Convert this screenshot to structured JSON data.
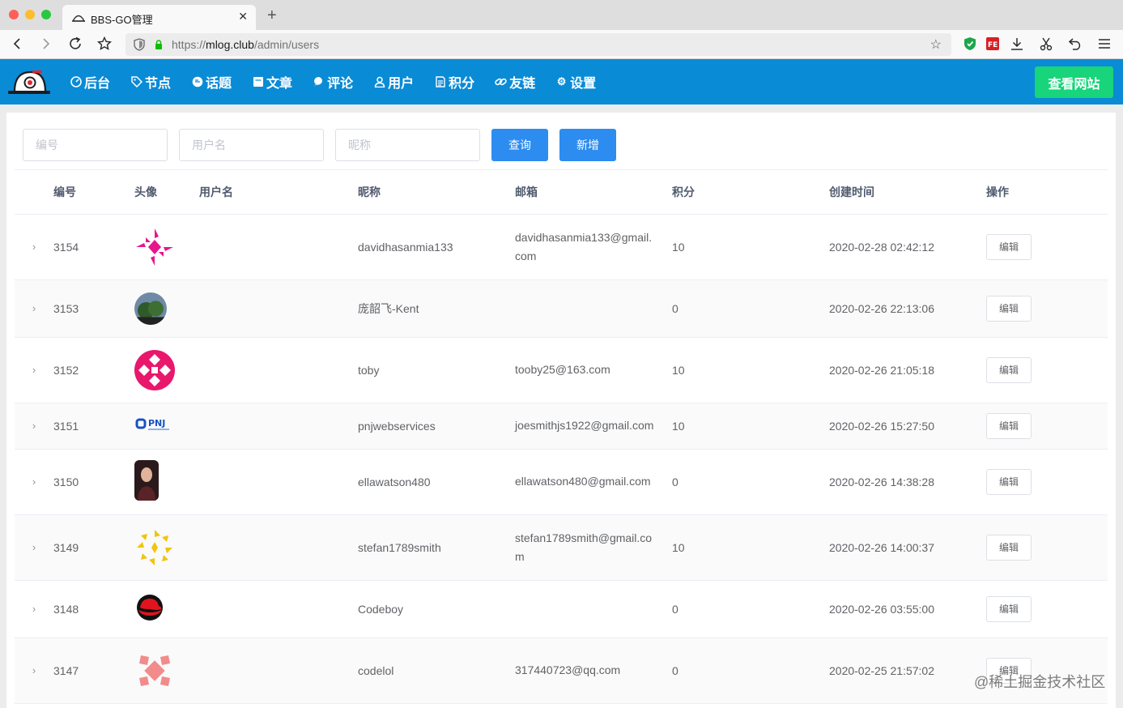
{
  "browser": {
    "tab_title": "BBS-GO管理",
    "url_prefix": "https://",
    "url_host": "mlog.club",
    "url_path": "/admin/users"
  },
  "header": {
    "menu": [
      {
        "label": "后台",
        "icon": "dashboard-icon"
      },
      {
        "label": "节点",
        "icon": "tag-icon"
      },
      {
        "label": "话题",
        "icon": "chat-bubble-icon"
      },
      {
        "label": "文章",
        "icon": "document-icon"
      },
      {
        "label": "评论",
        "icon": "comment-icon"
      },
      {
        "label": "用户",
        "icon": "user-icon"
      },
      {
        "label": "积分",
        "icon": "list-icon"
      },
      {
        "label": "友链",
        "icon": "link-icon"
      },
      {
        "label": "设置",
        "icon": "gear-icon"
      }
    ],
    "view_site": "查看网站"
  },
  "filters": {
    "id_placeholder": "编号",
    "username_placeholder": "用户名",
    "nickname_placeholder": "昵称",
    "query": "查询",
    "add": "新增"
  },
  "table": {
    "columns": [
      "编号",
      "头像",
      "用户名",
      "昵称",
      "邮箱",
      "积分",
      "创建时间",
      "操作"
    ],
    "edit_label": "编辑",
    "rows": [
      {
        "id": "3154",
        "username": "",
        "nickname": "davidhasanmia133",
        "email": "davidhasanmia133@gmail.com",
        "score": "10",
        "created": "2020-02-28 02:42:12",
        "avatar": "pink-identicon"
      },
      {
        "id": "3153",
        "username": "",
        "nickname": "庞韶飞-Kent",
        "email": "",
        "score": "0",
        "created": "2020-02-26 22:13:06",
        "avatar": "photo-trees"
      },
      {
        "id": "3152",
        "username": "",
        "nickname": "toby",
        "email": "tooby25@163.com",
        "score": "10",
        "created": "2020-02-26 21:05:18",
        "avatar": "magenta-identicon"
      },
      {
        "id": "3151",
        "username": "",
        "nickname": "pnjwebservices",
        "email": "joesmithjs1922@gmail.com",
        "score": "10",
        "created": "2020-02-26 15:27:50",
        "avatar": "pnj-logo"
      },
      {
        "id": "3150",
        "username": "",
        "nickname": "ellawatson480",
        "email": "ellawatson480@gmail.com",
        "score": "0",
        "created": "2020-02-26 14:38:28",
        "avatar": "photo-portrait"
      },
      {
        "id": "3149",
        "username": "",
        "nickname": "stefan1789smith",
        "email": "stefan1789smith@gmail.com",
        "score": "10",
        "created": "2020-02-26 14:00:37",
        "avatar": "yellow-identicon"
      },
      {
        "id": "3148",
        "username": "",
        "nickname": "Codeboy",
        "email": "",
        "score": "0",
        "created": "2020-02-26 03:55:00",
        "avatar": "redhat-logo"
      },
      {
        "id": "3147",
        "username": "",
        "nickname": "codelol",
        "email": "317440723@qq.com",
        "score": "0",
        "created": "2020-02-25 21:57:02",
        "avatar": "salmon-identicon"
      }
    ]
  },
  "watermark": "@稀土掘金技术社区"
}
